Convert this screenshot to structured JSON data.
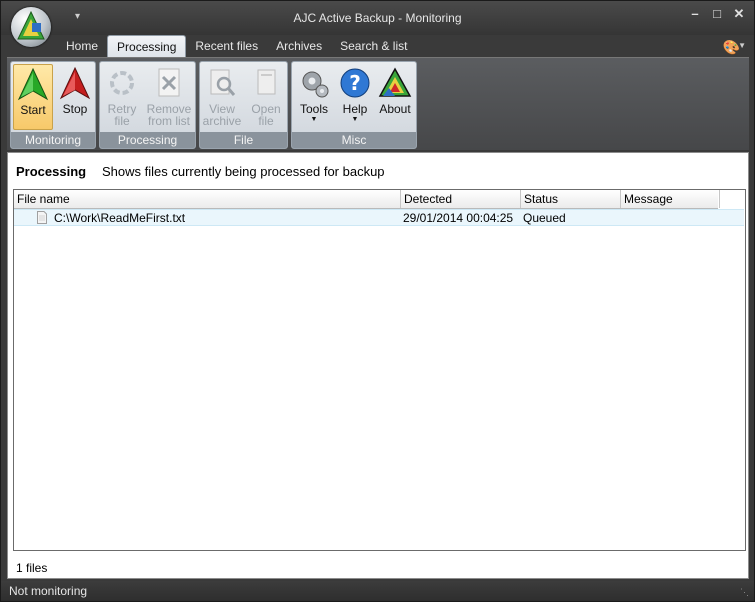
{
  "window": {
    "title": "AJC Active Backup - Monitoring"
  },
  "tabs": [
    {
      "label": "Home"
    },
    {
      "label": "Processing",
      "active": true
    },
    {
      "label": "Recent files"
    },
    {
      "label": "Archives"
    },
    {
      "label": "Search & list"
    }
  ],
  "ribbon": {
    "groups": {
      "monitoring": {
        "label": "Monitoring"
      },
      "processing": {
        "label": "Processing"
      },
      "file": {
        "label": "File"
      },
      "misc": {
        "label": "Misc"
      }
    },
    "buttons": {
      "start": {
        "label": "Start",
        "icon": "green-arrow-up-icon"
      },
      "stop": {
        "label": "Stop",
        "icon": "red-arrow-up-icon"
      },
      "retry_line1": "Retry",
      "retry_line2": "file",
      "remove_line1": "Remove",
      "remove_line2": "from list",
      "view_line1": "View",
      "view_line2": "archive",
      "open_line1": "Open",
      "open_line2": "file",
      "tools": {
        "label": "Tools",
        "icon": "gears-icon"
      },
      "help": {
        "label": "Help",
        "icon": "help-icon"
      },
      "about": {
        "label": "About",
        "icon": "triangle-logo-icon"
      }
    }
  },
  "page": {
    "title": "Processing",
    "description": "Shows files currently being processed for backup"
  },
  "table": {
    "columns": [
      "File name",
      "Detected",
      "Status",
      "Message"
    ],
    "rows": [
      {
        "file": "C:\\Work\\ReadMeFirst.txt",
        "detected": "29/01/2014 00:04:25",
        "status": "Queued",
        "message": ""
      }
    ]
  },
  "footer": {
    "count": "1 files"
  },
  "statusbar": {
    "text": "Not monitoring"
  },
  "colors": {
    "accent": "#f7c96a",
    "ribbon": "#cfd5dc",
    "frame": "#3a3a3a",
    "selection": "#eaf6fc"
  }
}
